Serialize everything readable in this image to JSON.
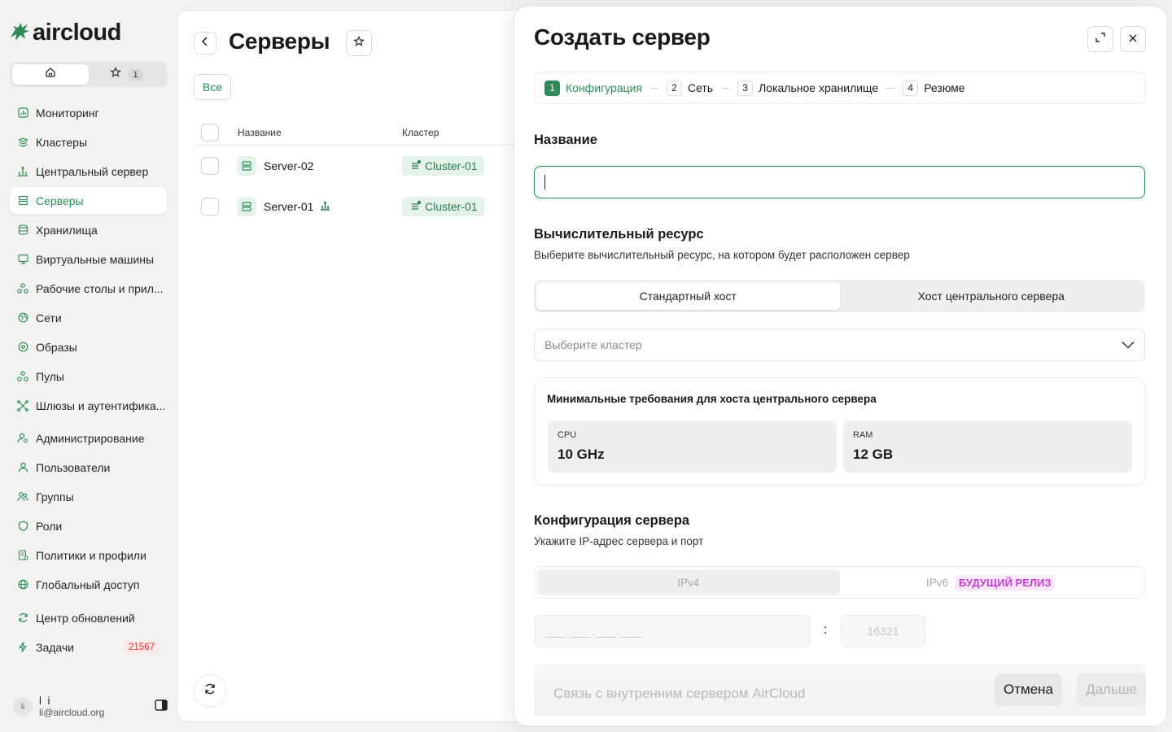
{
  "brand": {
    "name": "aircloud",
    "accent": "#2e8b57"
  },
  "switcher": {
    "home_icon": "home-icon",
    "fav_icon": "star-icon",
    "fav_count": "1"
  },
  "sidebar": {
    "items": [
      {
        "label": "Мониторинг",
        "icon": "chart-icon"
      },
      {
        "label": "Кластеры",
        "icon": "layers-icon"
      },
      {
        "label": "Центральный сервер",
        "icon": "hub-icon"
      },
      {
        "label": "Серверы",
        "icon": "server-icon",
        "active": true
      },
      {
        "label": "Хранилища",
        "icon": "database-icon"
      },
      {
        "label": "Виртуальные машины",
        "icon": "monitor-icon"
      },
      {
        "label": "Рабочие столы и прил...",
        "icon": "apps-icon"
      },
      {
        "label": "Сети",
        "icon": "network-icon"
      },
      {
        "label": "Образы",
        "icon": "disc-icon"
      },
      {
        "label": "Пулы",
        "icon": "pool-icon"
      },
      {
        "label": "Шлюзы и аутентифика...",
        "icon": "gateway-icon"
      },
      {
        "label": "Администрирование",
        "icon": "admin-icon"
      },
      {
        "label": "Пользователи",
        "icon": "user-icon"
      },
      {
        "label": "Группы",
        "icon": "group-icon"
      },
      {
        "label": "Роли",
        "icon": "shield-icon"
      },
      {
        "label": "Политики и профили",
        "icon": "policy-icon"
      },
      {
        "label": "Глобальный доступ",
        "icon": "globe-icon"
      },
      {
        "label": "Центр обновлений",
        "icon": "refresh-icon"
      },
      {
        "label": "Задачи",
        "icon": "bolt-icon",
        "badge": "21567"
      }
    ]
  },
  "user": {
    "initials": "li",
    "name": "l i",
    "email": "li@aircloud.org"
  },
  "main": {
    "title": "Серверы",
    "filter_all": "Все",
    "columns": {
      "name": "Название",
      "cluster": "Кластер"
    },
    "rows": [
      {
        "name": "Server-02",
        "cluster": "Cluster-01"
      },
      {
        "name": "Server-01",
        "cluster": "Cluster-01",
        "extra_icon": "hub-icon"
      }
    ]
  },
  "drawer": {
    "title": "Создать сервер",
    "steps": [
      {
        "num": "1",
        "label": "Конфигурация",
        "active": true
      },
      {
        "num": "2",
        "label": "Сеть"
      },
      {
        "num": "3",
        "label": "Локальное хранилище"
      },
      {
        "num": "4",
        "label": "Резюме"
      }
    ],
    "name_section": {
      "title": "Название",
      "value": ""
    },
    "compute": {
      "title": "Вычислительный ресурс",
      "subtitle": "Выберите вычислительный ресурс, на котором будет расположен сервер",
      "options": [
        "Стандартный хост",
        "Хост центрального сервера"
      ],
      "selected": "Стандартный хост",
      "cluster_placeholder": "Выберите кластер"
    },
    "requirements": {
      "title": "Минимальные требования для хоста центрального сервера",
      "cpu_label": "CPU",
      "cpu_value": "10 GHz",
      "ram_label": "RAM",
      "ram_value": "12 GB"
    },
    "server_config": {
      "title": "Конфигурация сервера",
      "subtitle": "Укажите IP-адрес сервера и порт",
      "ipv4": "IPv4",
      "ipv6": "IPv6",
      "future_badge": "БУДУЩИЙ РЕЛИЗ",
      "ip_placeholder": "___.___.___.___",
      "colon": ":",
      "port_placeholder": "16321"
    },
    "footer": {
      "note": "Связь с внутренним сервером AirCloud",
      "cancel": "Отмена",
      "next": "Дальше"
    }
  }
}
